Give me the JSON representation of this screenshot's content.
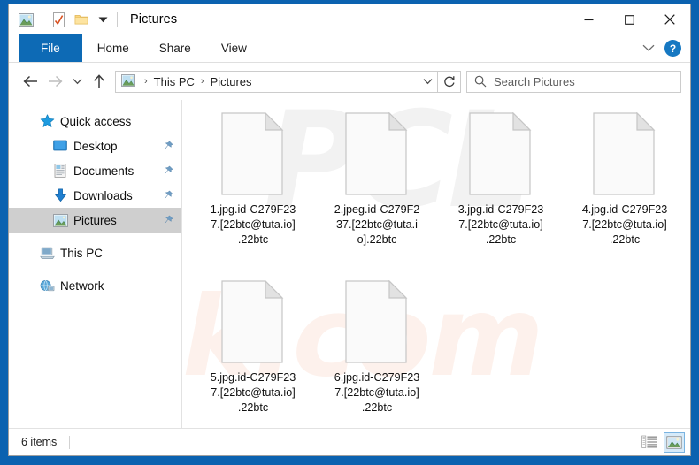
{
  "window": {
    "title": "Pictures",
    "quick_access_toolbar": [
      {
        "name": "pictures-folder-icon",
        "label": "Pictures"
      },
      {
        "name": "properties-icon",
        "label": "Properties"
      },
      {
        "name": "new-folder-icon",
        "label": "New folder"
      },
      {
        "name": "customize-chevron-icon",
        "label": "Customize Quick Access Toolbar"
      }
    ],
    "controls": {
      "minimize": "–",
      "maximize": "□",
      "close": "✕"
    }
  },
  "ribbon": {
    "tabs": [
      {
        "label": "File",
        "active": true
      },
      {
        "label": "Home",
        "active": false
      },
      {
        "label": "Share",
        "active": false
      },
      {
        "label": "View",
        "active": false
      }
    ],
    "collapse_label": "⌄",
    "help_label": "?"
  },
  "navigation": {
    "back_label": "←",
    "forward_label": "→",
    "recent_label": "⌄",
    "up_label": "↑",
    "refresh_label": "↻",
    "breadcrumb": [
      {
        "label": "This PC"
      },
      {
        "label": "Pictures"
      }
    ],
    "breadcrumb_separator": "›",
    "address_dropdown_label": "⌄"
  },
  "search": {
    "placeholder": "Search Pictures",
    "value": "",
    "icon": "search-icon"
  },
  "sidebar": {
    "items": [
      {
        "label": "Quick access",
        "icon": "star-icon",
        "level": 0,
        "selected": false,
        "pinned": false
      },
      {
        "label": "Desktop",
        "icon": "desktop-icon",
        "level": 1,
        "selected": false,
        "pinned": true
      },
      {
        "label": "Documents",
        "icon": "documents-icon",
        "level": 1,
        "selected": false,
        "pinned": true
      },
      {
        "label": "Downloads",
        "icon": "downloads-icon",
        "level": 1,
        "selected": false,
        "pinned": true
      },
      {
        "label": "Pictures",
        "icon": "pictures-icon",
        "level": 1,
        "selected": true,
        "pinned": true
      },
      {
        "label": "This PC",
        "icon": "this-pc-icon",
        "level": 0,
        "selected": false,
        "pinned": false
      },
      {
        "label": "Network",
        "icon": "network-icon",
        "level": 0,
        "selected": false,
        "pinned": false
      }
    ],
    "pin_icon": "pin-icon"
  },
  "files": [
    {
      "name": "1.jpg.id-C279F237.[22btc@tuta.io].22btc",
      "display": "1.jpg.id-C279F23\n7.[22btc@tuta.io]\n.22btc",
      "icon": "generic-file-icon"
    },
    {
      "name": "2.jpeg.id-C279F237.[22btc@tuta.io].22btc",
      "display": "2.jpeg.id-C279F2\n37.[22btc@tuta.i\no].22btc",
      "icon": "generic-file-icon"
    },
    {
      "name": "3.jpg.id-C279F237.[22btc@tuta.io].22btc",
      "display": "3.jpg.id-C279F23\n7.[22btc@tuta.io]\n.22btc",
      "icon": "generic-file-icon"
    },
    {
      "name": "4.jpg.id-C279F237.[22btc@tuta.io].22btc",
      "display": "4.jpg.id-C279F23\n7.[22btc@tuta.io]\n.22btc",
      "icon": "generic-file-icon"
    },
    {
      "name": "5.jpg.id-C279F237.[22btc@tuta.io].22btc",
      "display": "5.jpg.id-C279F23\n7.[22btc@tuta.io]\n.22btc",
      "icon": "generic-file-icon"
    },
    {
      "name": "6.jpg.id-C279F237.[22btc@tuta.io].22btc",
      "display": "6.jpg.id-C279F23\n7.[22btc@tuta.io]\n.22btc",
      "icon": "generic-file-icon"
    }
  ],
  "statusbar": {
    "item_count": "6 items",
    "views": [
      {
        "name": "details-view-button",
        "active": false
      },
      {
        "name": "large-icons-view-button",
        "active": true
      }
    ]
  },
  "watermark": {
    "top_text": "PCL",
    "bottom_text": "risk.com"
  },
  "colors": {
    "desktop_blue": "#0b62b0",
    "accent_blue": "#0d6ab5",
    "selection_gray": "#cfcfcf",
    "help_blue": "#1678c2",
    "view_active_border": "#7ab3e0"
  }
}
